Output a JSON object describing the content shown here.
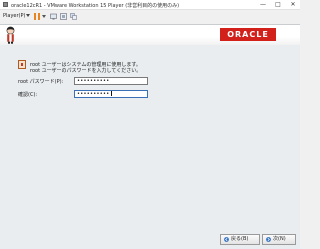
{
  "window": {
    "title": "oracle12cR1 - VMware Workstation 15 Player (非営利目的の使用のみ)",
    "controls": [
      "—",
      "□",
      "✕"
    ]
  },
  "toolbar": {
    "player_menu": "Player(P)",
    "icons": [
      "pause-icon",
      "vm-settings-icon",
      "fullscreen-icon",
      "unity-icon"
    ]
  },
  "installer": {
    "brand": "ORACLE",
    "message_lines": [
      "root ユーザーはシステムの管理用に使用します。",
      "root ユーザーのパスワードを入力してください。"
    ],
    "fields": [
      {
        "label": "root パスワード(P):",
        "value": "••••••••••"
      },
      {
        "label": "確認(C):",
        "value": "••••••••••"
      }
    ],
    "buttons": {
      "back": "戻る(B)",
      "next": "次(N)"
    }
  },
  "colors": {
    "oracle_red": "#d2201a",
    "accent": "#e8851f",
    "nav_arrow": "#2f6fc0"
  }
}
